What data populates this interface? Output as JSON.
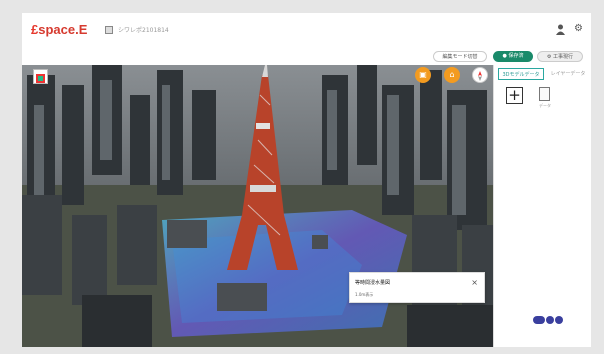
{
  "app": {
    "logo_prefix": "£",
    "logo_rest": "space.E",
    "project_name": "シワレポ2101814"
  },
  "header": {
    "pill_a": "編集モード切替",
    "pill_b": "● 保存済",
    "pill_c": "⚙ 工事現行"
  },
  "side_panel": {
    "tab_active": "3Dモデルデータ",
    "tab_other": "レイヤーデータ",
    "add_label": "+",
    "file_label": "データ"
  },
  "popup": {
    "title": "等時間浸水量図",
    "subtitle": "1.0m表示",
    "close_label": "×"
  },
  "map_buttons": {
    "layers": "▣",
    "home": "⌂",
    "compass": "⬆"
  },
  "colors": {
    "accent": "#1a8a6a",
    "logo": "#e6392e",
    "map_button": "#f39b20",
    "tower": "#c0452a"
  }
}
